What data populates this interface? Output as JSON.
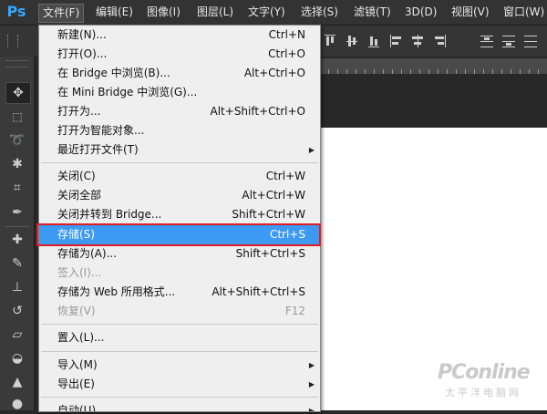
{
  "app": {
    "logo": "Ps"
  },
  "menubar": {
    "items": [
      "文件(F)",
      "编辑(E)",
      "图像(I)",
      "图层(L)",
      "文字(Y)",
      "选择(S)",
      "滤镜(T)",
      "3D(D)",
      "视图(V)",
      "窗口(W)"
    ],
    "active_index": 0
  },
  "file_menu": {
    "items": [
      {
        "label": "新建(N)...",
        "shortcut": "Ctrl+N",
        "enabled": true
      },
      {
        "label": "打开(O)...",
        "shortcut": "Ctrl+O",
        "enabled": true
      },
      {
        "label": "在 Bridge 中浏览(B)...",
        "shortcut": "Alt+Ctrl+O",
        "enabled": true
      },
      {
        "label": "在 Mini Bridge 中浏览(G)...",
        "shortcut": "",
        "enabled": true
      },
      {
        "label": "打开为...",
        "shortcut": "Alt+Shift+Ctrl+O",
        "enabled": true
      },
      {
        "label": "打开为智能对象...",
        "shortcut": "",
        "enabled": true
      },
      {
        "label": "最近打开文件(T)",
        "shortcut": "",
        "enabled": true,
        "submenu": true
      },
      {
        "label": "关闭(C)",
        "shortcut": "Ctrl+W",
        "enabled": true
      },
      {
        "label": "关闭全部",
        "shortcut": "Alt+Ctrl+W",
        "enabled": true
      },
      {
        "label": "关闭并转到 Bridge...",
        "shortcut": "Shift+Ctrl+W",
        "enabled": true
      },
      {
        "label": "存储(S)",
        "shortcut": "Ctrl+S",
        "enabled": true,
        "highlighted": true
      },
      {
        "label": "存储为(A)...",
        "shortcut": "Shift+Ctrl+S",
        "enabled": true
      },
      {
        "label": "签入(I)...",
        "shortcut": "",
        "enabled": false
      },
      {
        "label": "存储为 Web 所用格式...",
        "shortcut": "Alt+Shift+Ctrl+S",
        "enabled": true
      },
      {
        "label": "恢复(V)",
        "shortcut": "F12",
        "enabled": false
      },
      {
        "label": "置入(L)...",
        "shortcut": "",
        "enabled": true
      },
      {
        "label": "导入(M)",
        "shortcut": "",
        "enabled": true,
        "submenu": true
      },
      {
        "label": "导出(E)",
        "shortcut": "",
        "enabled": true,
        "submenu": true
      },
      {
        "label": "自动(U)",
        "shortcut": "",
        "enabled": true,
        "submenu": true
      }
    ]
  },
  "tools": [
    "move-tool",
    "marquee-tool",
    "lasso-tool",
    "magic-wand-tool",
    "crop-tool",
    "eyedropper-tool",
    "healing-brush-tool",
    "brush-tool",
    "clone-stamp-tool",
    "history-brush-tool",
    "eraser-tool",
    "paint-bucket-tool",
    "blur-tool",
    "dodge-tool"
  ],
  "watermark": {
    "main": "PConline",
    "sub": "太平洋电脑网"
  },
  "colors": {
    "highlight": "#3c99f4",
    "highlight_outline": "#e01c24",
    "brand": "#31a8ff"
  }
}
